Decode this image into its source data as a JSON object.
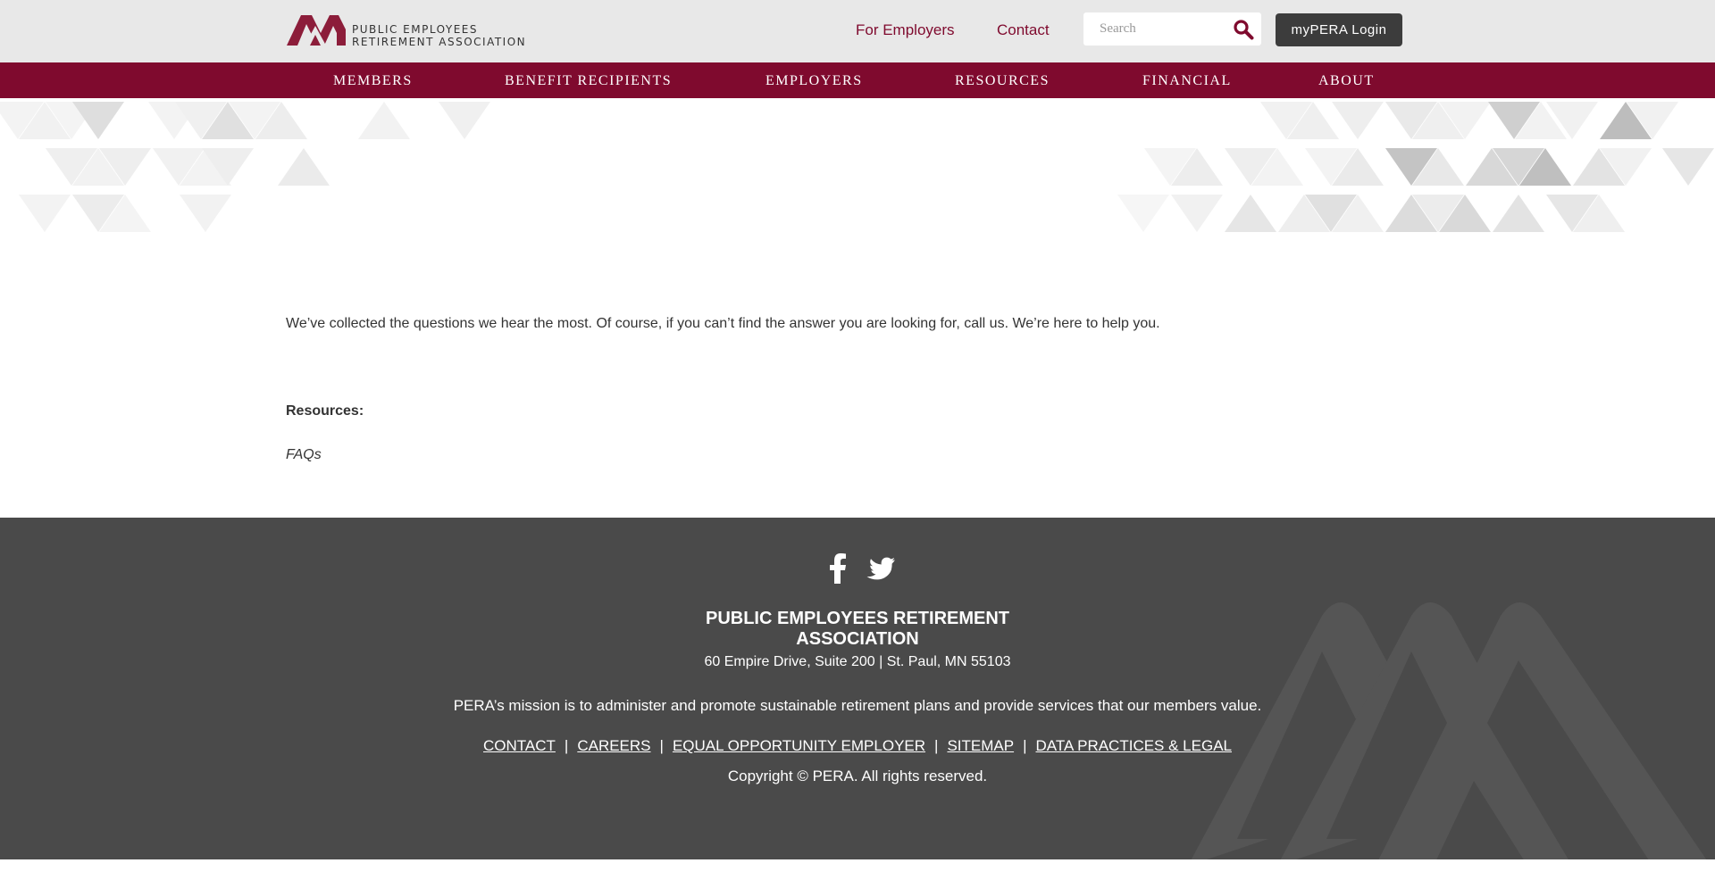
{
  "header": {
    "logo_line1": "PUBLIC EMPLOYEES",
    "logo_line2": "RETIREMENT ASSOCIATION",
    "for_employers": "For Employers",
    "contact": "Contact",
    "search_placeholder": "Search",
    "login": "myPERA Login"
  },
  "nav": {
    "items": [
      "MEMBERS",
      "BENEFIT RECIPIENTS",
      "EMPLOYERS",
      "RESOURCES",
      "FINANCIAL",
      "ABOUT"
    ]
  },
  "main": {
    "intro": "We’ve collected the questions we hear the most. Of course, if you can’t find the answer you are looking for, call us. We’re here to help you.",
    "resources_label": "Resources:",
    "faq_link": "FAQs"
  },
  "footer": {
    "name_line1": "PUBLIC EMPLOYEES RETIREMENT",
    "name_line2": "ASSOCIATION",
    "address": "60 Empire Drive, Suite 200 | St. Paul, MN 55103",
    "mission": "PERA’s mission is to administer and promote sustainable retirement plans and provide services that our members value.",
    "links": [
      "CONTACT",
      "CAREERS",
      "EQUAL OPPORTUNITY EMPLOYER",
      "SITEMAP",
      "DATA PRACTICES & LEGAL"
    ],
    "separator": "|",
    "copyright": "Copyright © PERA. All rights reserved."
  },
  "icons": {
    "logo": "pera-logo-icon",
    "search": "search-icon",
    "facebook": "facebook-icon",
    "twitter": "twitter-icon"
  },
  "colors": {
    "brand": "#7f0a2e",
    "topbar": "#e8e8e8",
    "footer": "#4a4a4a",
    "login_button": "#3c3c3c"
  }
}
